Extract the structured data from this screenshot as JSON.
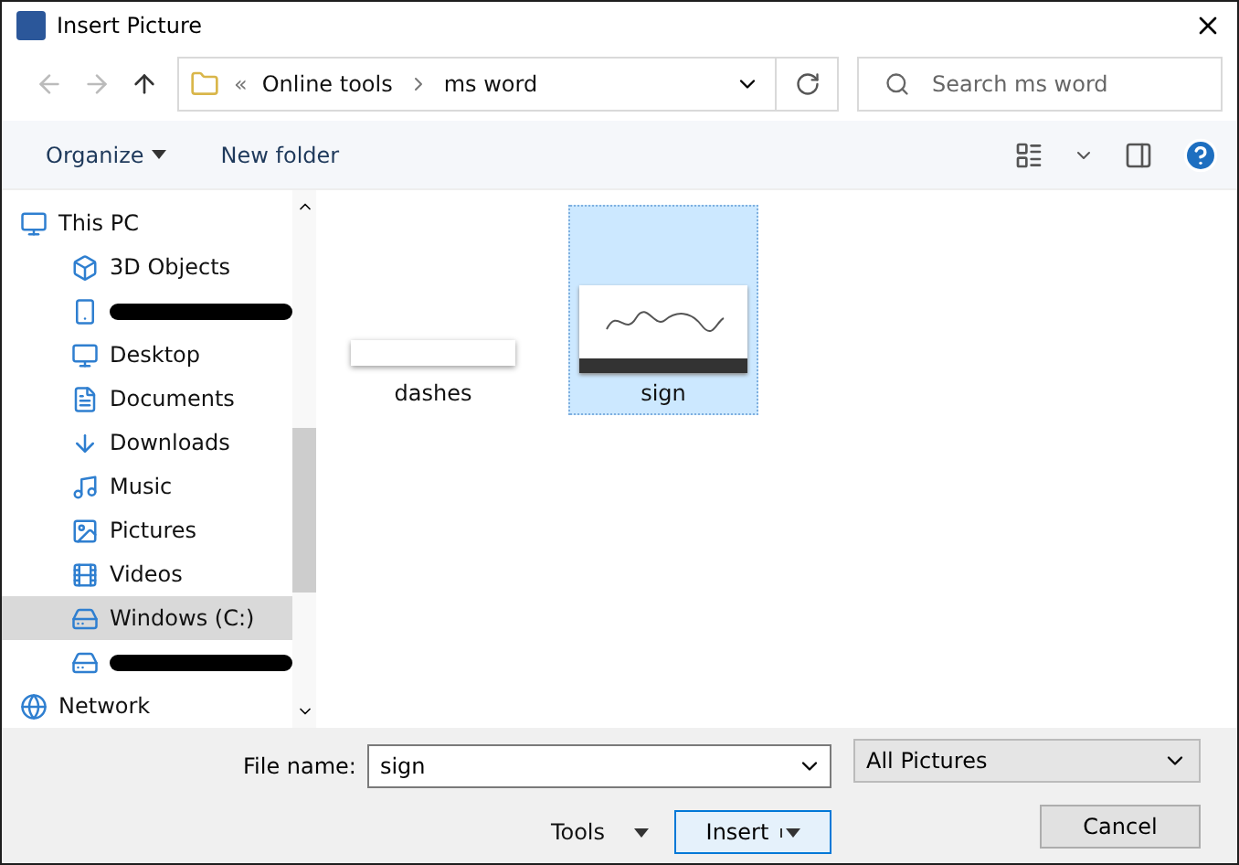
{
  "window": {
    "title": "Insert Picture"
  },
  "address": {
    "overflow": "«",
    "crumbs": [
      "Online tools",
      "ms word"
    ]
  },
  "search": {
    "placeholder": "Search ms word"
  },
  "toolbar": {
    "organize": "Organize",
    "new_folder": "New folder"
  },
  "sidebar": {
    "items": [
      {
        "kind": "pc",
        "label": "This PC",
        "selected": false,
        "redacted": false
      },
      {
        "kind": "cube",
        "label": "3D Objects",
        "selected": false,
        "redacted": false
      },
      {
        "kind": "phone",
        "selected": false,
        "redacted": true
      },
      {
        "kind": "desktop",
        "label": "Desktop",
        "selected": false,
        "redacted": false
      },
      {
        "kind": "doc",
        "label": "Documents",
        "selected": false,
        "redacted": false
      },
      {
        "kind": "download",
        "label": "Downloads",
        "selected": false,
        "redacted": false
      },
      {
        "kind": "music",
        "label": "Music",
        "selected": false,
        "redacted": false
      },
      {
        "kind": "picture",
        "label": "Pictures",
        "selected": false,
        "redacted": false
      },
      {
        "kind": "video",
        "label": "Videos",
        "selected": false,
        "redacted": false
      },
      {
        "kind": "drive",
        "label": "Windows (C:)",
        "selected": true,
        "redacted": false
      },
      {
        "kind": "drive",
        "selected": false,
        "redacted": true
      },
      {
        "kind": "network",
        "label": "Network",
        "selected": false,
        "redacted": false
      }
    ]
  },
  "files": [
    {
      "name": "dashes",
      "kind": "strip",
      "selected": false
    },
    {
      "name": "sign",
      "kind": "signature",
      "selected": true
    }
  ],
  "footer": {
    "file_name_label": "File name:",
    "file_name": "sign",
    "filter": "All Pictures",
    "tools": "Tools",
    "insert": "Insert",
    "cancel": "Cancel"
  }
}
